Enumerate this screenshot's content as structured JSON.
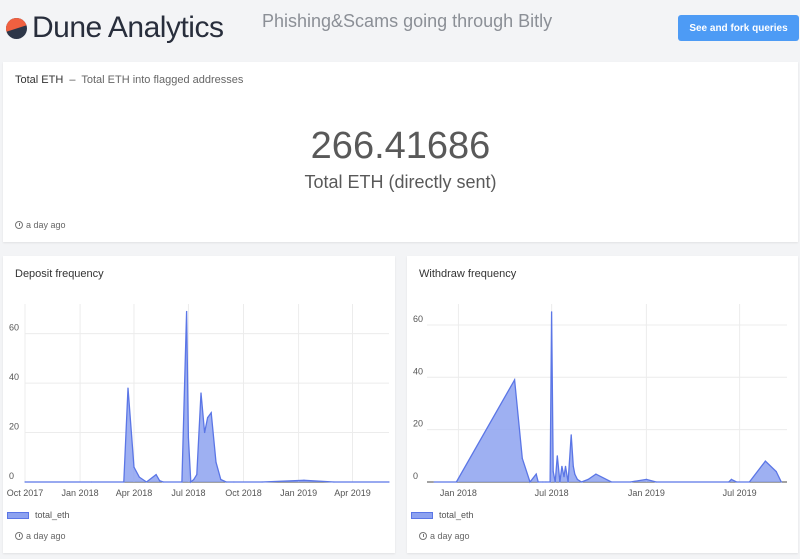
{
  "header": {
    "logo_text": "Dune Analytics",
    "dashboard_title": "Phishing&Scams going through Bitly",
    "fork_button": "See and fork queries"
  },
  "counter": {
    "name": "Total ETH",
    "separator": "–",
    "description": "Total ETH into flagged addresses",
    "value": "266.41686",
    "label": "Total ETH (directly sent)",
    "updated": "a day ago"
  },
  "chart_data": [
    {
      "type": "area",
      "title": "Deposit frequency",
      "series": [
        {
          "name": "total_eth",
          "color": "#5b76e6",
          "x": [
            "2017-10-01",
            "2018-01-20",
            "2018-03-15",
            "2018-03-22",
            "2018-04-01",
            "2018-04-10",
            "2018-04-22",
            "2018-05-08",
            "2018-05-14",
            "2018-05-20",
            "2018-06-20",
            "2018-06-28",
            "2018-07-01",
            "2018-07-05",
            "2018-07-10",
            "2018-07-15",
            "2018-07-22",
            "2018-07-28",
            "2018-08-02",
            "2018-08-08",
            "2018-08-16",
            "2018-08-24",
            "2018-09-02",
            "2018-09-15",
            "2018-11-01",
            "2019-01-10",
            "2019-03-01",
            "2019-06-01"
          ],
          "y": [
            0,
            0,
            0,
            38,
            6,
            2,
            0,
            3,
            0.5,
            0,
            0,
            69,
            18,
            0,
            1,
            3,
            36,
            20,
            26,
            28,
            8,
            1,
            0,
            0,
            0,
            0.7,
            0,
            0
          ]
        }
      ],
      "x_ticks": [
        "Oct 2017",
        "Jan 2018",
        "Apr 2018",
        "Jul 2018",
        "Oct 2018",
        "Jan 2019",
        "Apr 2019"
      ],
      "y_ticks": [
        0,
        20,
        40,
        60
      ],
      "ylim": [
        0,
        72
      ],
      "legend": "bottom-left",
      "updated": "a day ago"
    },
    {
      "type": "area",
      "title": "Withdraw frequency",
      "series": [
        {
          "name": "total_eth",
          "color": "#5b76e6",
          "x": [
            "2017-11-15",
            "2017-12-28",
            "2018-04-20",
            "2018-05-05",
            "2018-05-20",
            "2018-06-01",
            "2018-06-05",
            "2018-06-14",
            "2018-06-20",
            "2018-06-28",
            "2018-07-01",
            "2018-07-04",
            "2018-07-08",
            "2018-07-12",
            "2018-07-17",
            "2018-07-21",
            "2018-07-25",
            "2018-07-28",
            "2018-08-02",
            "2018-08-08",
            "2018-08-12",
            "2018-08-15",
            "2018-08-20",
            "2018-08-28",
            "2018-09-10",
            "2018-09-25",
            "2018-10-25",
            "2018-12-01",
            "2019-01-01",
            "2019-01-20",
            "2019-06-10",
            "2019-06-15",
            "2019-06-25",
            "2019-07-20",
            "2019-08-20",
            "2019-09-10",
            "2019-09-20"
          ],
          "y": [
            0,
            0,
            39,
            9,
            0,
            3,
            0,
            0,
            0,
            0,
            65,
            4,
            0,
            10,
            0,
            6,
            2,
            6,
            0,
            18,
            6,
            3,
            1,
            0,
            1,
            3,
            0,
            0,
            1,
            0,
            0,
            1,
            0,
            0,
            8,
            4,
            0
          ]
        }
      ],
      "x_ticks": [
        "Jan 2018",
        "Jul 2018",
        "Jan 2019",
        "Jul 2019"
      ],
      "y_ticks": [
        0,
        20,
        40,
        60
      ],
      "ylim": [
        0,
        68
      ],
      "legend": "bottom-left",
      "updated": "a day ago"
    }
  ]
}
